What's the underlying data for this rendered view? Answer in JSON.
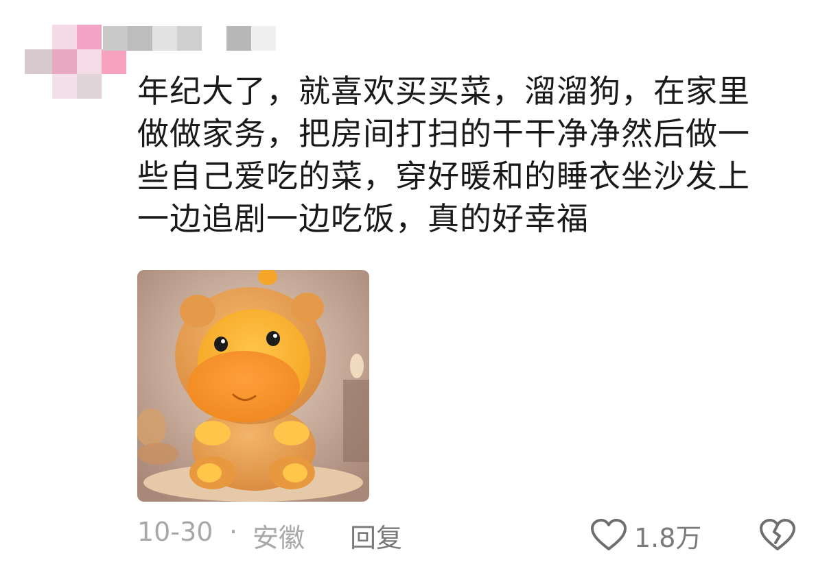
{
  "comment": {
    "lines": [
      "年纪大了，就喜欢买买菜，溜溜狗，在家里",
      "做做家务，把房间打扫的干干净净然后做一",
      "些自己爱吃的菜，穿好暖和的睡衣坐沙发上",
      "一边追剧一边吃饭，真的好幸福"
    ]
  },
  "footer": {
    "date": "10-30",
    "separator": "·",
    "location": "安徽",
    "reply_label": "回复",
    "like_count": "1.8万"
  },
  "icons": {
    "like": "heart-outline-icon",
    "dislike": "broken-heart-icon"
  },
  "colors": {
    "text": "#1a1a1a",
    "meta": "#a8a8a8",
    "action": "#7a7a7a",
    "avatar_pink": "#f2a5c4",
    "avatar_gray": "#c9c9c9"
  }
}
